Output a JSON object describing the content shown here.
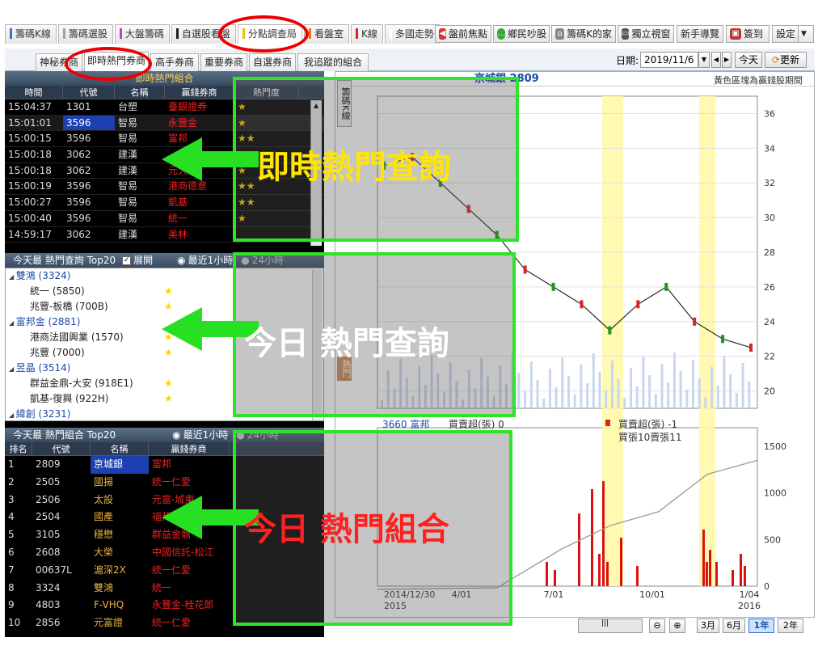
{
  "top_tabs": [
    {
      "label": "籌碼K線",
      "bar": "#3a70c8"
    },
    {
      "label": "籌碼選股",
      "bar": "#a0a0a0"
    },
    {
      "label": "大盤籌碼",
      "bar": "#c040c0"
    },
    {
      "label": "自選股看盤",
      "bar": "#202020"
    },
    {
      "label": "分點調查局",
      "bar": "#f0c000"
    },
    {
      "label": "看盤室",
      "bar": "#e08000"
    },
    {
      "label": "K線",
      "bar": "#e02020"
    },
    {
      "label": "多國走勢",
      "bar": "#ffffff"
    }
  ],
  "tool_buttons": [
    "盤前焦點",
    "鄉民吵股",
    "籌碼K的家",
    "獨立視窗",
    "新手導覽",
    "簽到",
    "設定"
  ],
  "sub_tabs": [
    "神秘券商",
    "即時熱門券商",
    "高手券商",
    "重要券商",
    "自選券商",
    "我追蹤的組合"
  ],
  "date": {
    "label": "日期:",
    "value": "2019/11/6",
    "today": "今天",
    "refresh": "更新"
  },
  "panel1": {
    "title": "即時熱門組合",
    "headers": [
      "時間",
      "代號",
      "名稱",
      "贏錢券商",
      "熱門度"
    ],
    "rows": [
      {
        "time": "15:04:37",
        "code": "1301",
        "name": "台塑",
        "broker": "臺銀證券",
        "stars": "★"
      },
      {
        "time": "15:01:01",
        "code": "3596",
        "name": "智易",
        "broker": "永豐金",
        "stars": "★"
      },
      {
        "time": "15:00:15",
        "code": "3596",
        "name": "智易",
        "broker": "富邦",
        "stars": "★★"
      },
      {
        "time": "15:00:18",
        "code": "3062",
        "name": "建漢",
        "broker": "",
        "stars": ""
      },
      {
        "time": "15:00:18",
        "code": "3062",
        "name": "建漢",
        "broker": "元大",
        "stars": "★"
      },
      {
        "time": "15:00:19",
        "code": "3596",
        "name": "智易",
        "broker": "港商德意",
        "stars": "★★"
      },
      {
        "time": "15:00:27",
        "code": "3596",
        "name": "智易",
        "broker": "凱基",
        "stars": "★★"
      },
      {
        "time": "15:00:40",
        "code": "3596",
        "name": "智易",
        "broker": "統一",
        "stars": "★"
      },
      {
        "time": "14:59:17",
        "code": "3062",
        "name": "建漢",
        "broker": "美林",
        "stars": ""
      }
    ]
  },
  "panel2": {
    "title": "今天最 熱門查詢 Top20",
    "expand": "展開",
    "opt1": "最近1小時",
    "opt2": "24小時",
    "tree": [
      {
        "type": "node",
        "text": "雙鴻 (3324)"
      },
      {
        "type": "leaf",
        "text": "統一 (5850)"
      },
      {
        "type": "leaf",
        "text": "兆豐-板橋 (700B)"
      },
      {
        "type": "node",
        "text": "富邦金 (2881)"
      },
      {
        "type": "leaf",
        "text": "港商法國興業 (1570)"
      },
      {
        "type": "leaf",
        "text": "兆豐 (7000)"
      },
      {
        "type": "node",
        "text": "昱晶 (3514)"
      },
      {
        "type": "leaf",
        "text": "群益金鼎-大安 (918E1)"
      },
      {
        "type": "leaf",
        "text": "凱基-復興 (922H)"
      },
      {
        "type": "node",
        "text": "緯創 (3231)"
      }
    ]
  },
  "panel3": {
    "title": "今天最 熱門組合 Top20",
    "opt1": "最近1小時",
    "opt2": "24小時",
    "headers": [
      "排名",
      "代號",
      "名稱",
      "贏錢券商"
    ],
    "rows": [
      {
        "rank": "1",
        "code": "2809",
        "name": "京城銀",
        "broker": "富邦"
      },
      {
        "rank": "2",
        "code": "2505",
        "name": "國揚",
        "broker": "統一仁愛"
      },
      {
        "rank": "3",
        "code": "2506",
        "name": "太設",
        "broker": "元富-城東"
      },
      {
        "rank": "4",
        "code": "2504",
        "name": "國產",
        "broker": "福邦"
      },
      {
        "rank": "5",
        "code": "3105",
        "name": "穩懋",
        "broker": "群益金鼎"
      },
      {
        "rank": "6",
        "code": "2608",
        "name": "大榮",
        "broker": "中國信託-松江"
      },
      {
        "rank": "7",
        "code": "00637L",
        "name": "滬深2X",
        "broker": "統一仁愛"
      },
      {
        "rank": "8",
        "code": "3324",
        "name": "雙鴻",
        "broker": "統一"
      },
      {
        "rank": "9",
        "code": "4803",
        "name": "F-VHQ",
        "broker": "永豐金-桂花郎"
      },
      {
        "rank": "10",
        "code": "2856",
        "name": "元富證",
        "broker": "統一仁愛"
      }
    ]
  },
  "chart": {
    "header_left": "京城銀 2809",
    "header_right": "黃色區塊為贏錢股期間",
    "side_tab": "籌碼K線",
    "side_tab2": "熱門",
    "price_ticks": [
      "36",
      "34",
      "32",
      "30",
      "28",
      "26",
      "24",
      "22",
      "20"
    ],
    "vol_ticks": [
      "1500",
      "1000",
      "500",
      "0"
    ],
    "x_labels": [
      "2014/12/30",
      "4/01",
      "7/01",
      "10/01",
      "1/04"
    ],
    "x_year1": "2015",
    "x_year2": "2016",
    "lower_text1": "3660 富邦",
    "lower_text2": "買賣超(張) 0",
    "legend1": "買賣超(張) -1",
    "legend2": "買張10賣張11"
  },
  "overlays": [
    {
      "text": "即時熱門查詢",
      "color": "#ffe600"
    },
    {
      "text": "今日 熱門查詢",
      "color": "#ffffff"
    },
    {
      "text": "今日 熱門組合",
      "color": "#ff2020"
    }
  ],
  "bottom_buttons": [
    "3月",
    "6月",
    "1年",
    "2年"
  ],
  "chart_data": {
    "type": "line",
    "title": "京城銀 2809",
    "x": [
      "2014/12/30",
      "4/01",
      "7/01",
      "10/01",
      "1/04"
    ],
    "ylim": [
      19,
      37
    ],
    "y_ticks": [
      20,
      22,
      24,
      26,
      28,
      30,
      32,
      34,
      36
    ],
    "series": [
      {
        "name": "京城銀 2809",
        "values": [
          33,
          33.5,
          32,
          30.5,
          29,
          27,
          26,
          25,
          23.5,
          25,
          26,
          24,
          23,
          22.5
        ]
      }
    ]
  }
}
